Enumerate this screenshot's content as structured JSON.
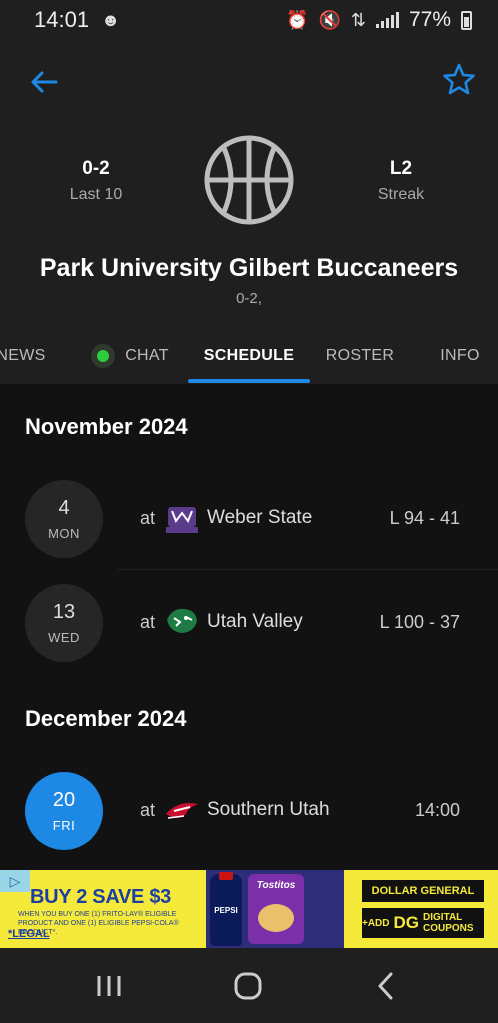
{
  "status_bar": {
    "time": "14:01",
    "battery_percent": "77%",
    "icons": [
      "notification-icon",
      "alarm-icon",
      "mute-icon",
      "data-icon",
      "signal-icon",
      "battery-icon"
    ]
  },
  "header": {
    "back_icon": "arrow-left-icon",
    "favorite_icon": "star-outline-icon",
    "left_stat": {
      "value": "0-2",
      "label": "Last 10"
    },
    "right_stat": {
      "value": "L2",
      "label": "Streak"
    },
    "team_logo": "basketball-icon",
    "team_name": "Park University Gilbert Buccaneers",
    "record": "0-2,"
  },
  "tabs": [
    {
      "label": "NEWS"
    },
    {
      "label": "CHAT"
    },
    {
      "label": "SCHEDULE"
    },
    {
      "label": "ROSTER"
    },
    {
      "label": "INFO"
    }
  ],
  "active_tab": "SCHEDULE",
  "schedule": {
    "months": [
      {
        "title": "November 2024",
        "games": [
          {
            "day": "4",
            "dow": "MON",
            "prefix": "at",
            "opponent": "Weber State",
            "logo": "weber-state-logo",
            "result": "L 94 - 41"
          },
          {
            "day": "13",
            "dow": "WED",
            "prefix": "at",
            "opponent": "Utah Valley",
            "logo": "utah-valley-logo",
            "result": "L 100 - 37"
          }
        ]
      },
      {
        "title": "December 2024",
        "games": [
          {
            "day": "20",
            "dow": "FRI",
            "prefix": "at",
            "opponent": "Southern Utah",
            "logo": "southern-utah-logo",
            "result": "14:00"
          }
        ]
      }
    ]
  },
  "ad": {
    "headline": "BUY 2 SAVE $3",
    "fine_print": "WHEN YOU BUY ONE (1) FRITO-LAY® ELIGIBLE PRODUCT AND ONE (1) ELIGIBLE PEPSI-COLA® PRODUCT*.",
    "legal": "*LEGAL",
    "bottle_label": "PEPSI",
    "bag_label": "Tostitos",
    "store": "DOLLAR GENERAL",
    "cta_prefix": "+ADD",
    "cta_brand": "DG",
    "cta_suffix": "DIGITAL COUPONS"
  },
  "nav": {
    "recents_icon": "recents-icon",
    "home_icon": "home-icon",
    "back_icon": "back-icon"
  },
  "colors": {
    "accent": "#1e88e5",
    "chat_online": "#2ecc40",
    "background": "#121212",
    "header_bg": "#1f1f1f"
  }
}
